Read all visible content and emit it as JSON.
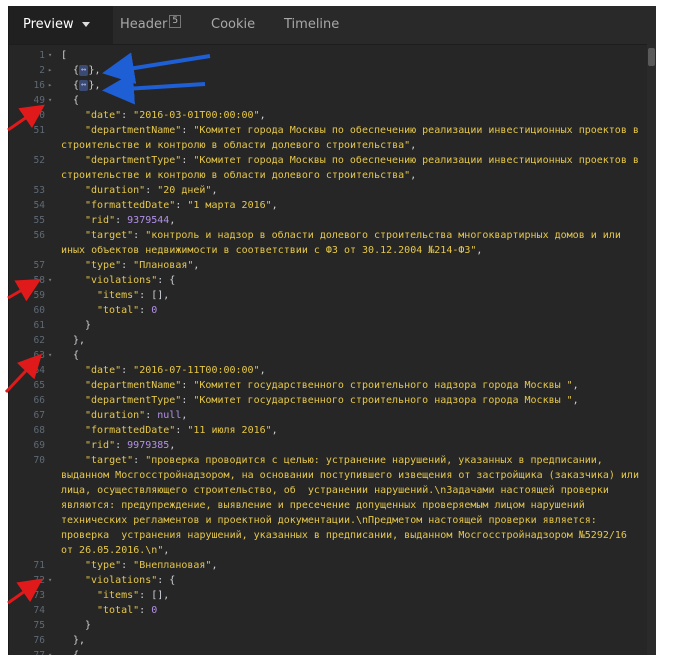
{
  "tabs": [
    {
      "label": "Preview",
      "active": true
    },
    {
      "label": "Header",
      "badge": "5"
    },
    {
      "label": "Cookie"
    },
    {
      "label": "Timeline"
    }
  ],
  "collapsed_marker": "↔",
  "lines": [
    {
      "num": "1",
      "fold": "▾",
      "ind": 0,
      "parts": [
        [
          "p",
          "["
        ]
      ]
    },
    {
      "num": "2",
      "fold": "▸",
      "ind": 1,
      "parts": [
        [
          "p",
          "{"
        ],
        [
          "c",
          "↔"
        ],
        [
          "p",
          "},"
        ]
      ]
    },
    {
      "num": "16",
      "fold": "▸",
      "ind": 1,
      "parts": [
        [
          "p",
          "{"
        ],
        [
          "c",
          "↔"
        ],
        [
          "p",
          "},"
        ]
      ]
    },
    {
      "num": "49",
      "fold": "▾",
      "ind": 1,
      "parts": [
        [
          "p",
          "{"
        ]
      ]
    },
    {
      "num": "50",
      "ind": 2,
      "parts": [
        [
          "k",
          "\"date\""
        ],
        [
          "p",
          ": "
        ],
        [
          "s",
          "\"2016-03-01T00:00:00\""
        ],
        [
          "p",
          ","
        ]
      ]
    },
    {
      "num": "51",
      "ind": 2,
      "parts": [
        [
          "k",
          "\"departmentName\""
        ],
        [
          "p",
          ": "
        ],
        [
          "s",
          "\"Комитет города Москвы по обеспечению реализации инвестиционных проектов в"
        ]
      ]
    },
    {
      "num": "",
      "ind": 0,
      "parts": [
        [
          "s",
          "строительстве и контролю в области долевого строительства\""
        ],
        [
          "p",
          ","
        ]
      ]
    },
    {
      "num": "52",
      "ind": 2,
      "parts": [
        [
          "k",
          "\"departmentType\""
        ],
        [
          "p",
          ": "
        ],
        [
          "s",
          "\"Комитет города Москвы по обеспечению реализации инвестиционных проектов в"
        ]
      ]
    },
    {
      "num": "",
      "ind": 0,
      "parts": [
        [
          "s",
          "строительстве и контролю в области долевого строительства\""
        ],
        [
          "p",
          ","
        ]
      ]
    },
    {
      "num": "53",
      "ind": 2,
      "parts": [
        [
          "k",
          "\"duration\""
        ],
        [
          "p",
          ": "
        ],
        [
          "s",
          "\"20 дней\""
        ],
        [
          "p",
          ","
        ]
      ]
    },
    {
      "num": "54",
      "ind": 2,
      "parts": [
        [
          "k",
          "\"formattedDate\""
        ],
        [
          "p",
          ": "
        ],
        [
          "s",
          "\"1 марта 2016\""
        ],
        [
          "p",
          ","
        ]
      ]
    },
    {
      "num": "55",
      "ind": 2,
      "parts": [
        [
          "k",
          "\"rid\""
        ],
        [
          "p",
          ": "
        ],
        [
          "n",
          "9379544"
        ],
        [
          "p",
          ","
        ]
      ]
    },
    {
      "num": "56",
      "ind": 2,
      "parts": [
        [
          "k",
          "\"target\""
        ],
        [
          "p",
          ": "
        ],
        [
          "s",
          "\"контроль и надзор в области долевого строительства многоквартирных домов и или"
        ]
      ]
    },
    {
      "num": "",
      "ind": 0,
      "parts": [
        [
          "s",
          "иных объектов недвижимости в соответствии с ФЗ от 30.12.2004 №214-ФЗ\""
        ],
        [
          "p",
          ","
        ]
      ]
    },
    {
      "num": "57",
      "ind": 2,
      "parts": [
        [
          "k",
          "\"type\""
        ],
        [
          "p",
          ": "
        ],
        [
          "s",
          "\"Плановая\""
        ],
        [
          "p",
          ","
        ]
      ]
    },
    {
      "num": "58",
      "fold": "▾",
      "ind": 2,
      "parts": [
        [
          "k",
          "\"violations\""
        ],
        [
          "p",
          ": {"
        ]
      ]
    },
    {
      "num": "59",
      "ind": 3,
      "parts": [
        [
          "k",
          "\"items\""
        ],
        [
          "p",
          ": [],"
        ]
      ]
    },
    {
      "num": "60",
      "ind": 3,
      "parts": [
        [
          "k",
          "\"total\""
        ],
        [
          "p",
          ": "
        ],
        [
          "n",
          "0"
        ]
      ]
    },
    {
      "num": "61",
      "ind": 2,
      "parts": [
        [
          "p",
          "}"
        ]
      ]
    },
    {
      "num": "62",
      "ind": 1,
      "parts": [
        [
          "p",
          "},"
        ]
      ]
    },
    {
      "num": "63",
      "fold": "▾",
      "ind": 1,
      "parts": [
        [
          "p",
          "{"
        ]
      ]
    },
    {
      "num": "64",
      "ind": 2,
      "parts": [
        [
          "k",
          "\"date\""
        ],
        [
          "p",
          ": "
        ],
        [
          "s",
          "\"2016-07-11T00:00:00\""
        ],
        [
          "p",
          ","
        ]
      ]
    },
    {
      "num": "65",
      "ind": 2,
      "parts": [
        [
          "k",
          "\"departmentName\""
        ],
        [
          "p",
          ": "
        ],
        [
          "s",
          "\"Комитет государственного строительного надзора города Москвы \""
        ],
        [
          "p",
          ","
        ]
      ]
    },
    {
      "num": "66",
      "ind": 2,
      "parts": [
        [
          "k",
          "\"departmentType\""
        ],
        [
          "p",
          ": "
        ],
        [
          "s",
          "\"Комитет государственного строительного надзора города Москвы \""
        ],
        [
          "p",
          ","
        ]
      ]
    },
    {
      "num": "67",
      "ind": 2,
      "parts": [
        [
          "k",
          "\"duration\""
        ],
        [
          "p",
          ": "
        ],
        [
          "lit",
          "null"
        ],
        [
          "p",
          ","
        ]
      ]
    },
    {
      "num": "68",
      "ind": 2,
      "parts": [
        [
          "k",
          "\"formattedDate\""
        ],
        [
          "p",
          ": "
        ],
        [
          "s",
          "\"11 июля 2016\""
        ],
        [
          "p",
          ","
        ]
      ]
    },
    {
      "num": "69",
      "ind": 2,
      "parts": [
        [
          "k",
          "\"rid\""
        ],
        [
          "p",
          ": "
        ],
        [
          "n",
          "9979385"
        ],
        [
          "p",
          ","
        ]
      ]
    },
    {
      "num": "70",
      "ind": 2,
      "parts": [
        [
          "k",
          "\"target\""
        ],
        [
          "p",
          ": "
        ],
        [
          "s",
          "\"проверка проводится с целью: устранение нарушений, указанных в предписании,"
        ]
      ]
    },
    {
      "num": "",
      "ind": 0,
      "parts": [
        [
          "s",
          "выданном Мосгосстройнадзором, на основании поступившего извещения от застройщика (заказчика) или"
        ]
      ]
    },
    {
      "num": "",
      "ind": 0,
      "parts": [
        [
          "s",
          "лица, осуществляющего строительство, об  устранении нарушений.\\nЗадачами настоящей проверки"
        ]
      ]
    },
    {
      "num": "",
      "ind": 0,
      "parts": [
        [
          "s",
          "являются: предупреждение, выявление и пресечение допущенных проверяемым лицом нарушений"
        ]
      ]
    },
    {
      "num": "",
      "ind": 0,
      "parts": [
        [
          "s",
          "технических регламентов и проектной документации.\\nПредметом настоящей проверки является:"
        ]
      ]
    },
    {
      "num": "",
      "ind": 0,
      "parts": [
        [
          "s",
          "проверка  устранения нарушений, указанных в предписании, выданном Мосгосстройнадзором №5292/16"
        ]
      ]
    },
    {
      "num": "",
      "ind": 0,
      "parts": [
        [
          "s",
          "от 26.05.2016.\\n\""
        ],
        [
          "p",
          ","
        ]
      ]
    },
    {
      "num": "71",
      "ind": 2,
      "parts": [
        [
          "k",
          "\"type\""
        ],
        [
          "p",
          ": "
        ],
        [
          "s",
          "\"Внеплановая\""
        ],
        [
          "p",
          ","
        ]
      ]
    },
    {
      "num": "72",
      "fold": "▾",
      "ind": 2,
      "parts": [
        [
          "k",
          "\"violations\""
        ],
        [
          "p",
          ": {"
        ]
      ]
    },
    {
      "num": "73",
      "ind": 3,
      "parts": [
        [
          "k",
          "\"items\""
        ],
        [
          "p",
          ": [],"
        ]
      ]
    },
    {
      "num": "74",
      "ind": 3,
      "parts": [
        [
          "k",
          "\"total\""
        ],
        [
          "p",
          ": "
        ],
        [
          "n",
          "0"
        ]
      ]
    },
    {
      "num": "75",
      "ind": 2,
      "parts": [
        [
          "p",
          "}"
        ]
      ]
    },
    {
      "num": "76",
      "ind": 1,
      "parts": [
        [
          "p",
          "},"
        ]
      ]
    },
    {
      "num": "77",
      "fold": "▾",
      "ind": 1,
      "parts": [
        [
          "p",
          "{"
        ]
      ]
    }
  ]
}
